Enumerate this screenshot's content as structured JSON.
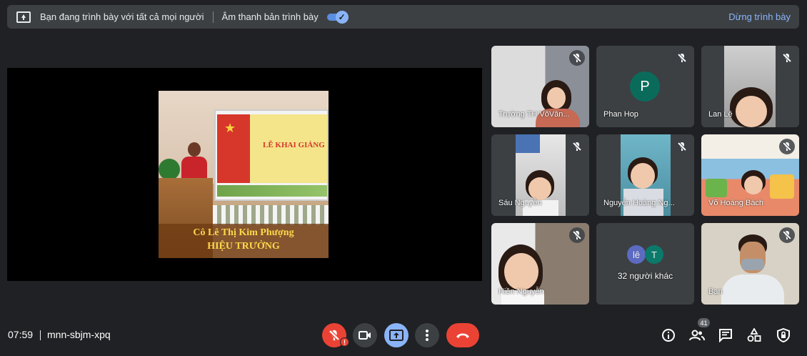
{
  "banner": {
    "presenting_text": "Bạn đang trình bày với tất cả mọi người",
    "audio_label": "Âm thanh bản trình bày",
    "audio_on": true,
    "stop_label": "Dừng trình bày"
  },
  "slide": {
    "caption_line1": "Cô Lê Thị Kim Phượng",
    "caption_line2": "HIỆU TRƯỞNG",
    "screen_title": "LỄ KHAI GIẢNG"
  },
  "participants": [
    {
      "name": "Trường TH VõVăn...",
      "muted": true
    },
    {
      "name": "Phan Hop",
      "initial": "P",
      "avatar_color": "#0b6b5b",
      "muted": true
    },
    {
      "name": "Lan Lê",
      "muted": true
    },
    {
      "name": "Sáu Nguyễn",
      "muted": true
    },
    {
      "name": "Nguyễn Hoàng Ng...",
      "muted": true
    },
    {
      "name": "Võ Hoàng Bách",
      "muted": true
    },
    {
      "name": "Hiền Nguyễn",
      "muted": true
    },
    {
      "name": "32 người khác",
      "initials": [
        "lê",
        "T"
      ],
      "colors": [
        "#5c6bc0",
        "#0b7a6b"
      ]
    },
    {
      "name": "Bạn",
      "muted": true
    }
  ],
  "footer": {
    "time": "07:59",
    "meeting_code": "mnn-sbjm-xpq",
    "people_count": "41",
    "mic_alert": "!"
  },
  "colors": {
    "end_call": "#ea4335",
    "present_active": "#8ab4f8",
    "background": "#202124"
  }
}
